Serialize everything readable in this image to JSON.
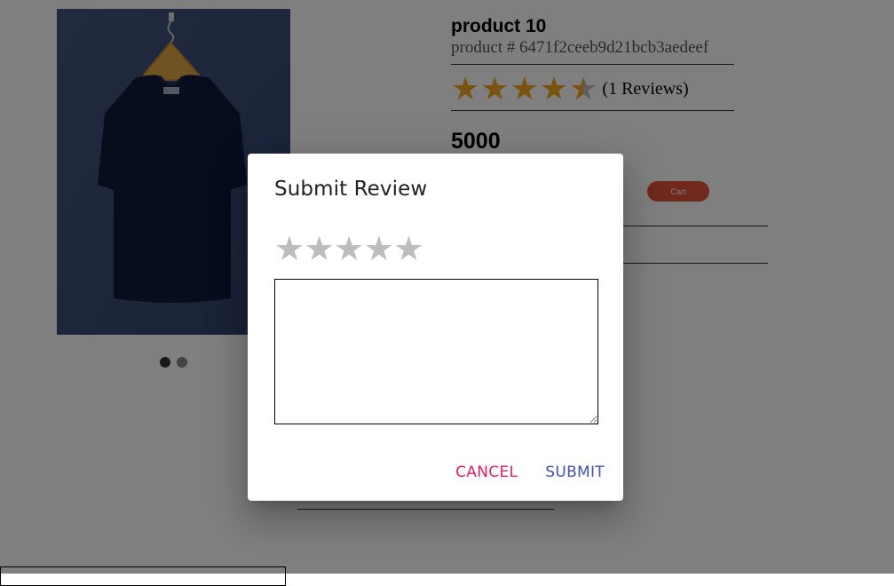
{
  "product": {
    "name": "product 10",
    "id_text": "product # 6471f2ceeb9d21bcb3aedeef",
    "rating": 4.5,
    "stars": [
      "star",
      "star",
      "star",
      "star",
      "star-half"
    ],
    "reviews_text": "(1 Reviews)",
    "price": "5000",
    "cart_label": "Cart",
    "image_icon": "t-shirt-icon",
    "carousel": {
      "count": 2,
      "active_index": 0
    }
  },
  "dialog": {
    "title": "Submit Review",
    "rating_stars": [
      "☆",
      "☆",
      "☆",
      "☆",
      "☆"
    ],
    "rating_value": 0,
    "textarea_value": "",
    "cancel_label": "CANCEL",
    "submit_label": "SUBMIT"
  },
  "colors": {
    "star_filled": "#f5a623",
    "star_empty": "#bdbdbd",
    "cancel": "#e91e63",
    "submit": "#3f51b5",
    "cart_button": "#e2543a"
  }
}
